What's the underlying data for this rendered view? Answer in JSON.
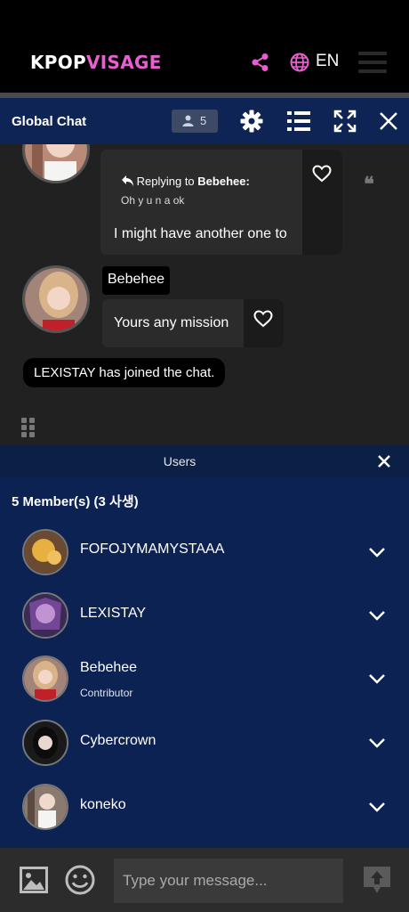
{
  "site": {
    "logo_part1": "KPOP",
    "logo_part2": "VISAGE",
    "language": "EN",
    "accent_color": "#e85fd0"
  },
  "chat_bar": {
    "title": "Global Chat",
    "user_count": "5",
    "icons": [
      "gear-icon",
      "list-icon",
      "fullscreen-icon",
      "close-icon"
    ]
  },
  "messages": {
    "reply": {
      "replying_prefix": "Replying to",
      "replying_to": "Bebehee:",
      "quoted_text": "Oh y u n a ok",
      "text": "I might have another one to"
    },
    "message2": {
      "author": "Bebehee",
      "text": "Yours any mission"
    },
    "system_note": "LEXISTAY has joined the chat."
  },
  "users_panel": {
    "title": "Users",
    "members_summary": "5 Member(s) (3 사생)",
    "users": [
      {
        "name": "FOFOJYMAMYSTAAA",
        "role": ""
      },
      {
        "name": "LEXISTAY",
        "role": ""
      },
      {
        "name": "Bebehee",
        "role": "Contributor"
      },
      {
        "name": "Cybercrown",
        "role": ""
      },
      {
        "name": "koneko",
        "role": ""
      }
    ]
  },
  "composer": {
    "placeholder": "Type your message..."
  }
}
